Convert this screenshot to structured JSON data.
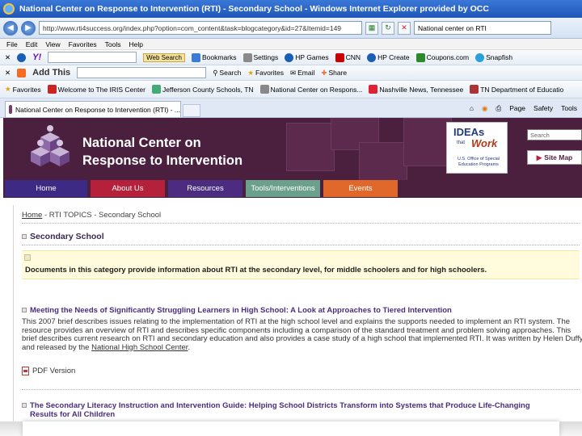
{
  "window": {
    "title": "National Center on Response to Intervention (RTI) - Secondary School - Windows Internet Explorer provided by OCC"
  },
  "address_bar": {
    "url": "http://www.rti4success.org/index.php?option=com_content&task=blogcategory&id=27&Itemid=149",
    "search_value": "National center on RTI"
  },
  "menu": [
    "File",
    "Edit",
    "View",
    "Favorites",
    "Tools",
    "Help"
  ],
  "toolbar_yahoo": {
    "logo": "Y!",
    "web_search": "Web Search",
    "items": [
      "Bookmarks",
      "Settings",
      "HP Games",
      "CNN",
      "HP Create",
      "Coupons.com",
      "Snapfish"
    ]
  },
  "toolbar_addthis": {
    "logo": "Add This",
    "search": "Search",
    "items": [
      "Favorites",
      "Email",
      "Share"
    ]
  },
  "favorites_bar": {
    "label": "Favorites",
    "items": [
      "Welcome to The IRIS Center",
      "Jefferson County Schools, TN",
      "National Center on Respons...",
      "Nashville News, Tennessee",
      "TN Department of Educatio"
    ]
  },
  "tab": {
    "label": "National Center on Response to Intervention (RTI) - ..."
  },
  "command_bar": [
    "Page",
    "Safety",
    "Tools"
  ],
  "site": {
    "title_line1": "National Center on",
    "title_line2": "Response to Intervention",
    "ideas_logo": {
      "ideas": "IDEAs",
      "that": "that",
      "work": "Work",
      "osep": "U.S. Office of Special Education Programs"
    },
    "search_placeholder": "Search",
    "sitemap_label": "Site Map",
    "nav": [
      "Home",
      "About Us",
      "Resources",
      "Tools/Interventions",
      "Events"
    ]
  },
  "content": {
    "breadcrumb_home": "Home",
    "breadcrumb_rest": " - RTI TOPICS - Secondary School",
    "section_heading": "Secondary School",
    "note": "Documents in this category provide information about RTI at the secondary level, for middle schoolers and for high schoolers.",
    "item1_title": "Meeting the Needs of Significantly Struggling Learners in High School: A Look at Approaches to Tiered Intervention",
    "item1_desc": "This 2007 brief describes issues relating to the implementation of RTI at the high school level and explains the supports needed to implement an RTI system. The resource provides an overview of RTI and describes specific components including a comparison of the standard treatment and problem solving approaches. This brief describes current research on RTI and secondary education and also provides a case study of a high school that implemented RTI. It was written by Helen Duffy and released by the",
    "item1_org": "National High School Center",
    "item1_end": ".",
    "pdf_label": "PDF Version",
    "item2_title_line1": "The Secondary Literacy Instruction and Intervention Guide: Helping School Districts Transform into Systems that Produce Life-Changing",
    "item2_title_line2": "Results for All Children"
  },
  "colors": {
    "header_bg": "#4b1f3e",
    "nav_home": "#3d2a84",
    "nav_about": "#b5213b",
    "nav_resources": "#4b2c80",
    "nav_tools": "#6aa08c",
    "nav_events": "#e0682a"
  }
}
